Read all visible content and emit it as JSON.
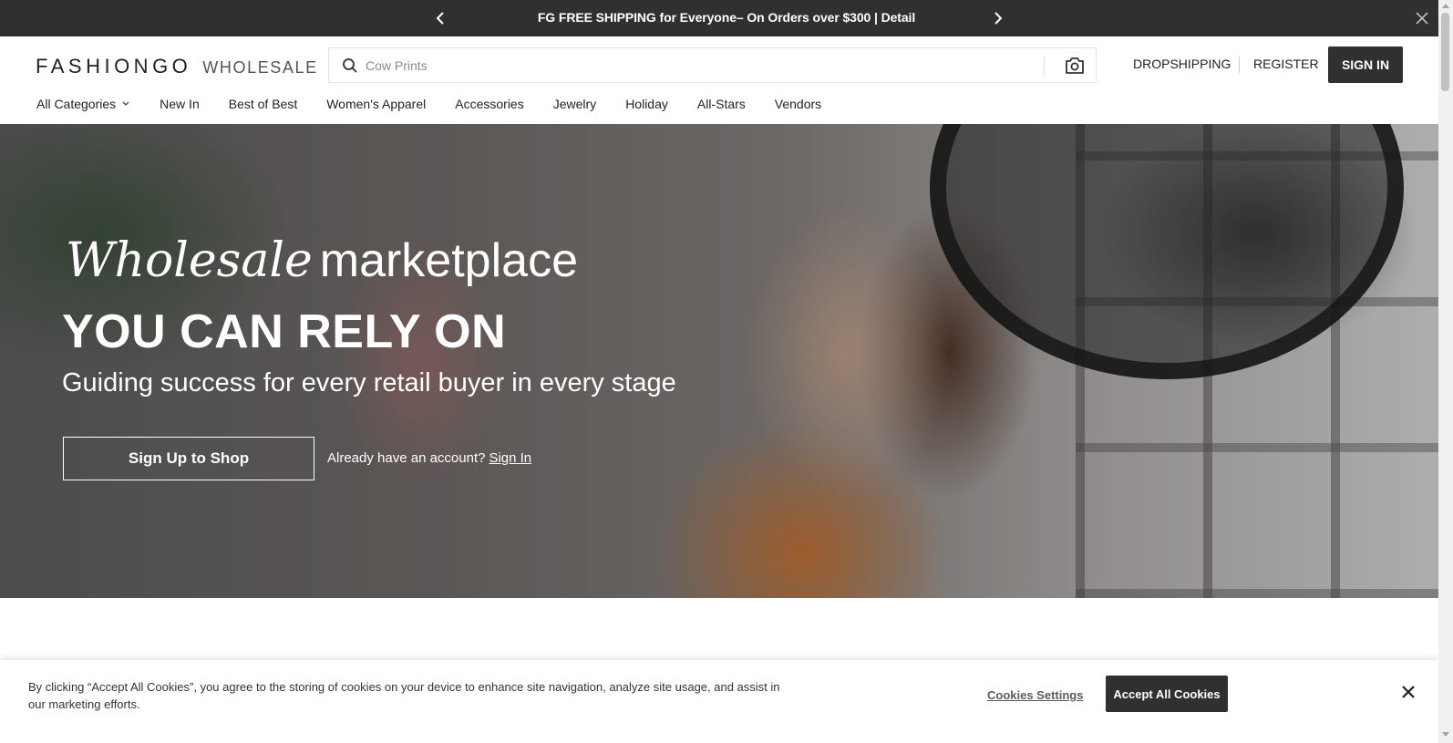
{
  "promo": {
    "text": "FG FREE SHIPPING for Everyone– On Orders over $300 | Detail",
    "prev_icon": "chevron-left-icon",
    "next_icon": "chevron-right-icon",
    "close_icon": "close-icon"
  },
  "header": {
    "logo_brand": "FASHIONGO",
    "logo_sub": "WHOLESALE",
    "search_placeholder": "Cow Prints",
    "dropshipping": "DROPSHIPPING",
    "register": "REGISTER",
    "sign_in": "SIGN IN"
  },
  "nav": {
    "items": [
      "All Categories",
      "New In",
      "Best of Best",
      "Women's Apparel",
      "Accessories",
      "Jewelry",
      "Holiday",
      "All-Stars",
      "Vendors"
    ]
  },
  "hero": {
    "line1_italic": "Wholesale",
    "line1_rest": "marketplace",
    "line2": "YOU CAN RELY ON",
    "line3": "Guiding success for every retail buyer in every stage",
    "cta": "Sign Up to Shop",
    "already": "Already have an account?",
    "sign_in_link": "Sign In"
  },
  "cookie": {
    "message": "By clicking “Accept All Cookies”, you agree to the storing of cookies on your device to enhance site navigation, analyze site usage, and assist in our marketing efforts.",
    "settings": "Cookies Settings",
    "accept": "Accept All Cookies"
  },
  "colors": {
    "dark": "#303030",
    "white": "#ffffff"
  }
}
